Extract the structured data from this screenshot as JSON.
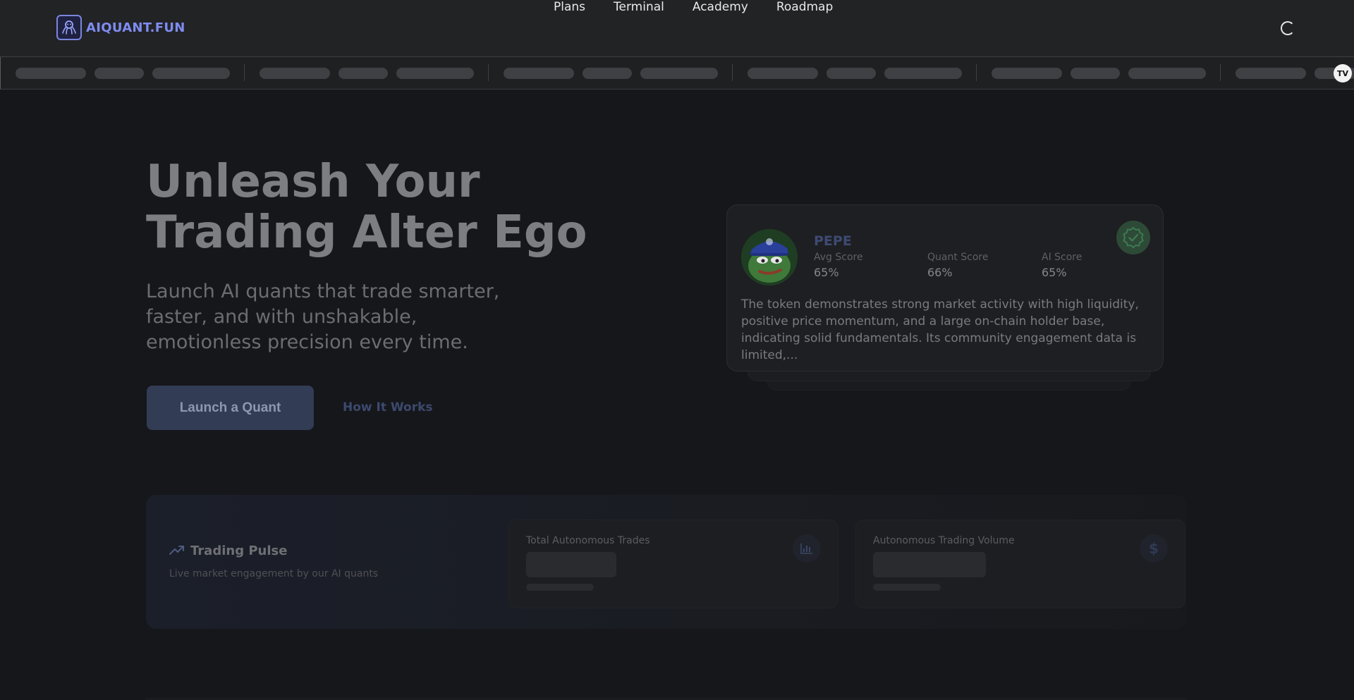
{
  "brand": {
    "name": "AIQUANT.FUN",
    "logo_icon": "octopus-icon"
  },
  "nav": {
    "items": [
      "Plans",
      "Terminal",
      "Academy",
      "Roadmap"
    ]
  },
  "ticker": {
    "state": "loading",
    "badge_text": "TV"
  },
  "hero": {
    "title_line1": "Unleash Your",
    "title_line2": "Trading Alter Ego",
    "subtitle": "Launch AI quants that trade smarter, faster, and with unshakable, emotionless precision every time.",
    "cta_primary": "Launch a Quant",
    "cta_secondary": "How It Works"
  },
  "token_card": {
    "name": "PEPE",
    "scores": [
      {
        "label": "Avg Score",
        "value": "65%"
      },
      {
        "label": "Quant Score",
        "value": "66%"
      },
      {
        "label": "AI Score",
        "value": "65%"
      }
    ],
    "description": "The token demonstrates strong market activity with high liquidity, positive price momentum, and a large on-chain holder base, indicating solid fundamentals. Its community engagement data is limited,...",
    "verified_icon": "check-badge-icon"
  },
  "pulse": {
    "title": "Trading Pulse",
    "subtitle": "Live market engagement by our AI quants",
    "stats": [
      {
        "label": "Total Autonomous Trades",
        "icon": "bar-chart-icon"
      },
      {
        "label": "Autonomous Trading Volume",
        "icon": "dollar-icon"
      }
    ]
  },
  "colors": {
    "background": "#16171b",
    "accent": "#7e8cf0",
    "verified": "#2d4a37"
  }
}
